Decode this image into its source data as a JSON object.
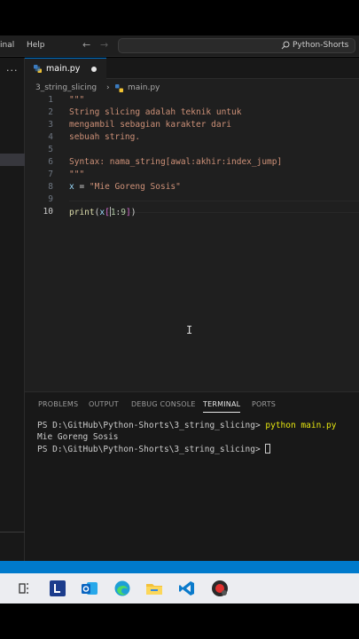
{
  "titlebar": {
    "menu_terminal": "inal",
    "menu_help": "Help",
    "search_text": "Python-Shorts"
  },
  "tab": {
    "label": "main.py",
    "modified": true
  },
  "breadcrumb": {
    "folder": "3_string_slicing",
    "file": "main.py"
  },
  "code": {
    "lines": [
      {
        "n": "1",
        "text": "\"\"\""
      },
      {
        "n": "2",
        "text": "String slicing adalah teknik untuk"
      },
      {
        "n": "3",
        "text": "mengambil sebagian karakter dari"
      },
      {
        "n": "4",
        "text": "sebuah string."
      },
      {
        "n": "5",
        "text": ""
      },
      {
        "n": "6",
        "text": "Syntax: nama_string[awal:akhir:index_jump]"
      },
      {
        "n": "7",
        "text": "\"\"\""
      },
      {
        "n": "8",
        "var": "x",
        "op": " = ",
        "str": "\"Mie Goreng Sosis\""
      },
      {
        "n": "9",
        "text": ""
      },
      {
        "n": "10",
        "fn": "print",
        "p1": "(",
        "var": "x",
        "b1": "[",
        "num1": "1",
        "colon": ":",
        "num2": "9",
        "b2": "]",
        "p2": ")"
      }
    ]
  },
  "panel": {
    "tabs": [
      "PROBLEMS",
      "OUTPUT",
      "DEBUG CONSOLE",
      "TERMINAL",
      "PORTS"
    ],
    "active_tab": "TERMINAL"
  },
  "terminal": {
    "prompt1": "PS D:\\GitHub\\Python-Shorts\\3_string_slicing> ",
    "command": "python main.py",
    "output": "Mie Goreng Sosis",
    "prompt2": "PS D:\\GitHub\\Python-Shorts\\3_string_slicing> "
  },
  "taskbar": {
    "icons": [
      "task-view-icon",
      "l-app-icon",
      "outlook-icon",
      "edge-icon",
      "file-explorer-icon",
      "vscode-icon",
      "screen-recorder-icon"
    ]
  },
  "colors": {
    "accent": "#007acc",
    "string": "#ce9178",
    "keyword_fn": "#dcdcaa",
    "variable": "#9cdcfe",
    "number": "#b5cea8"
  }
}
